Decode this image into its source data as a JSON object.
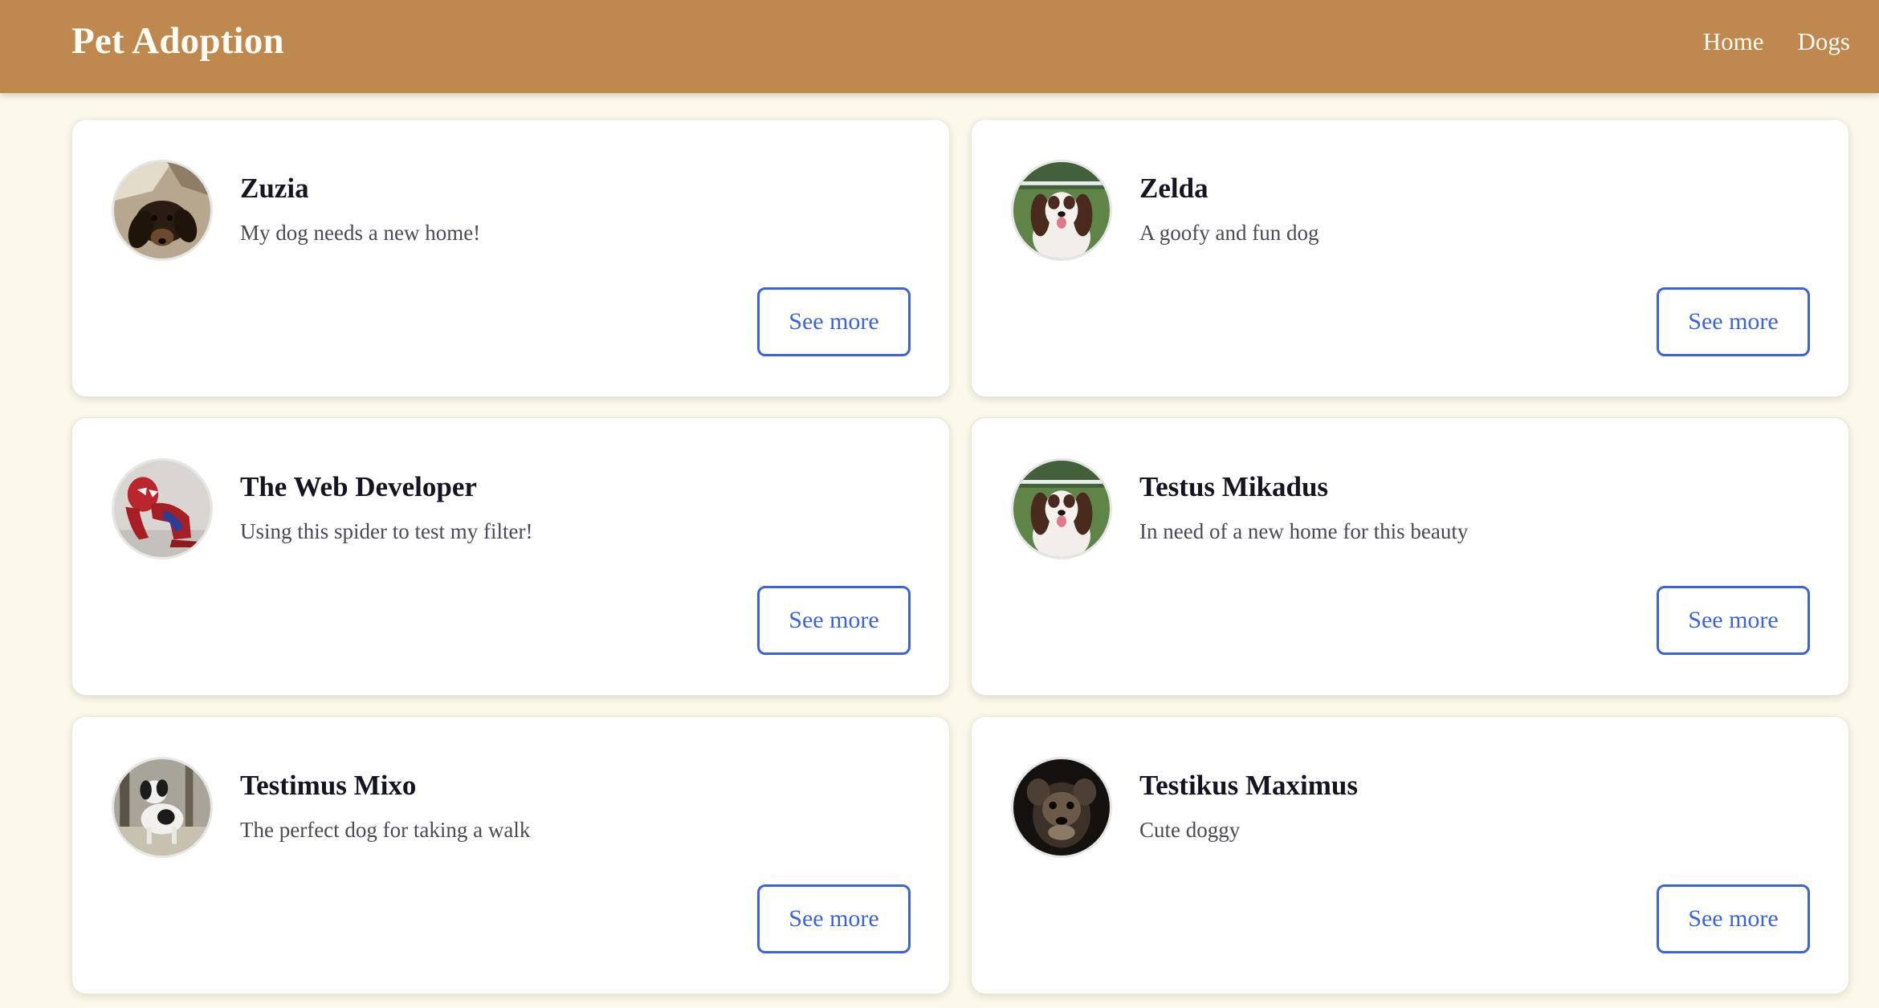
{
  "header": {
    "brand": "Pet Adoption",
    "nav": [
      "Home",
      "Dogs"
    ]
  },
  "pets": [
    {
      "name": "Zuzia",
      "description": "My dog needs a new home!",
      "button": "See more",
      "photo": "dachshund-photo"
    },
    {
      "name": "Zelda",
      "description": "A goofy and fun dog",
      "button": "See more",
      "photo": "spaniel-photo"
    },
    {
      "name": "The Web Developer",
      "description": "Using this spider to test my filter!",
      "button": "See more",
      "photo": "spider-figure-photo"
    },
    {
      "name": "Testus Mikadus",
      "description": "In need of a new home for this beauty",
      "button": "See more",
      "photo": "spaniel-photo"
    },
    {
      "name": "Testimus Mixo",
      "description": "The perfect dog for taking a walk",
      "button": "See more",
      "photo": "mixed-dog-photo"
    },
    {
      "name": "Testikus Maximus",
      "description": "Cute doggy",
      "button": "See more",
      "photo": "terrier-photo"
    }
  ],
  "colors": {
    "header": "#bf884f",
    "page_background": "#fdf9ea",
    "accent": "#3b63dd"
  }
}
